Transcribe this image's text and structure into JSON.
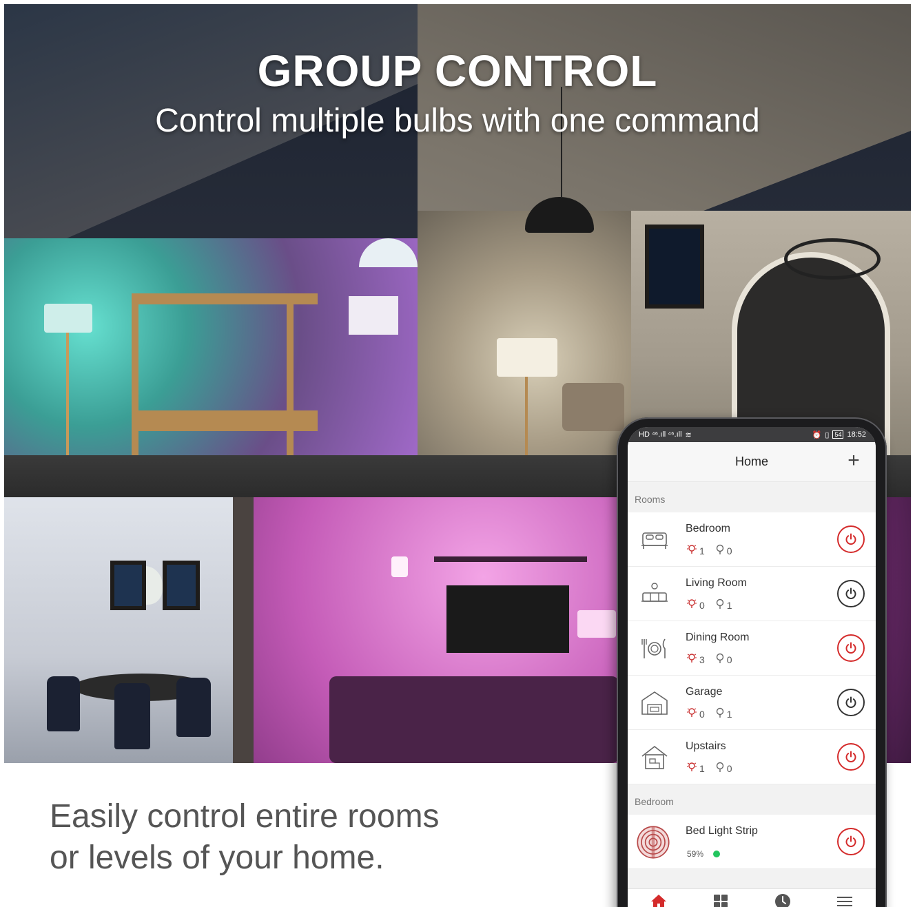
{
  "headline": "GROUP CONTROL",
  "subheadline": "Control multiple bulbs with one command",
  "caption": {
    "line1": "Easily control entire rooms",
    "line2": "or levels of your home."
  },
  "phone": {
    "status_bar": {
      "left": "HD ⁴⁶.ıll ⁴⁶.ıll",
      "right_time": "18:52",
      "battery": "54"
    },
    "app_bar": {
      "title": "Home",
      "add_label": "+"
    },
    "rooms_section_label": "Rooms",
    "rooms": [
      {
        "name": "Bedroom",
        "on_count": "1",
        "off_count": "0",
        "power": "on",
        "icon": "bed-icon"
      },
      {
        "name": "Living Room",
        "on_count": "0",
        "off_count": "1",
        "power": "off",
        "icon": "sofa-icon"
      },
      {
        "name": "Dining Room",
        "on_count": "3",
        "off_count": "0",
        "power": "on",
        "icon": "dining-icon"
      },
      {
        "name": "Garage",
        "on_count": "0",
        "off_count": "1",
        "power": "off",
        "icon": "garage-icon"
      },
      {
        "name": "Upstairs",
        "on_count": "1",
        "off_count": "0",
        "power": "on",
        "icon": "house-icon"
      }
    ],
    "device_section_label": "Bedroom",
    "devices": [
      {
        "name": "Bed Light Strip",
        "brightness": "59%",
        "status_color": "#22c55e",
        "power": "on",
        "icon": "light-strip-icon"
      }
    ],
    "bottom_nav": [
      "home-icon",
      "grid-icon",
      "clock-icon",
      "menu-icon"
    ]
  },
  "colors": {
    "power_on": "#d42b2b",
    "power_off": "#333333",
    "nav_active": "#d42b2b"
  }
}
